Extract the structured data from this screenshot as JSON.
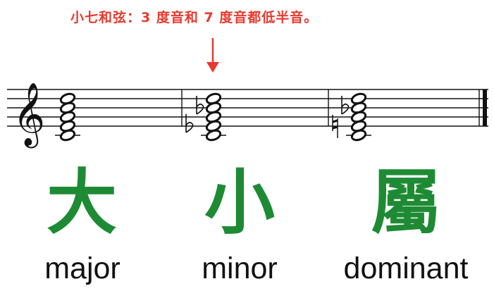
{
  "annotation": "小七和弦：3 度音和 7 度音都低半音。",
  "chords": [
    {
      "chinese": "大",
      "english": "major",
      "accidentals": []
    },
    {
      "chinese": "小",
      "english": "minor",
      "accidentals": [
        "flat",
        "flat"
      ]
    },
    {
      "chinese": "屬",
      "english": "dominant",
      "accidentals": [
        "natural",
        "flat"
      ]
    }
  ],
  "colors": {
    "annotation": "#e8392e",
    "arrow": "#e8392e",
    "label": "#1e8b34",
    "staff": "#111111"
  },
  "icons": {
    "clef": "treble-clef-icon",
    "arrow": "down-arrow-icon",
    "flat": "flat-icon",
    "natural": "natural-icon"
  }
}
